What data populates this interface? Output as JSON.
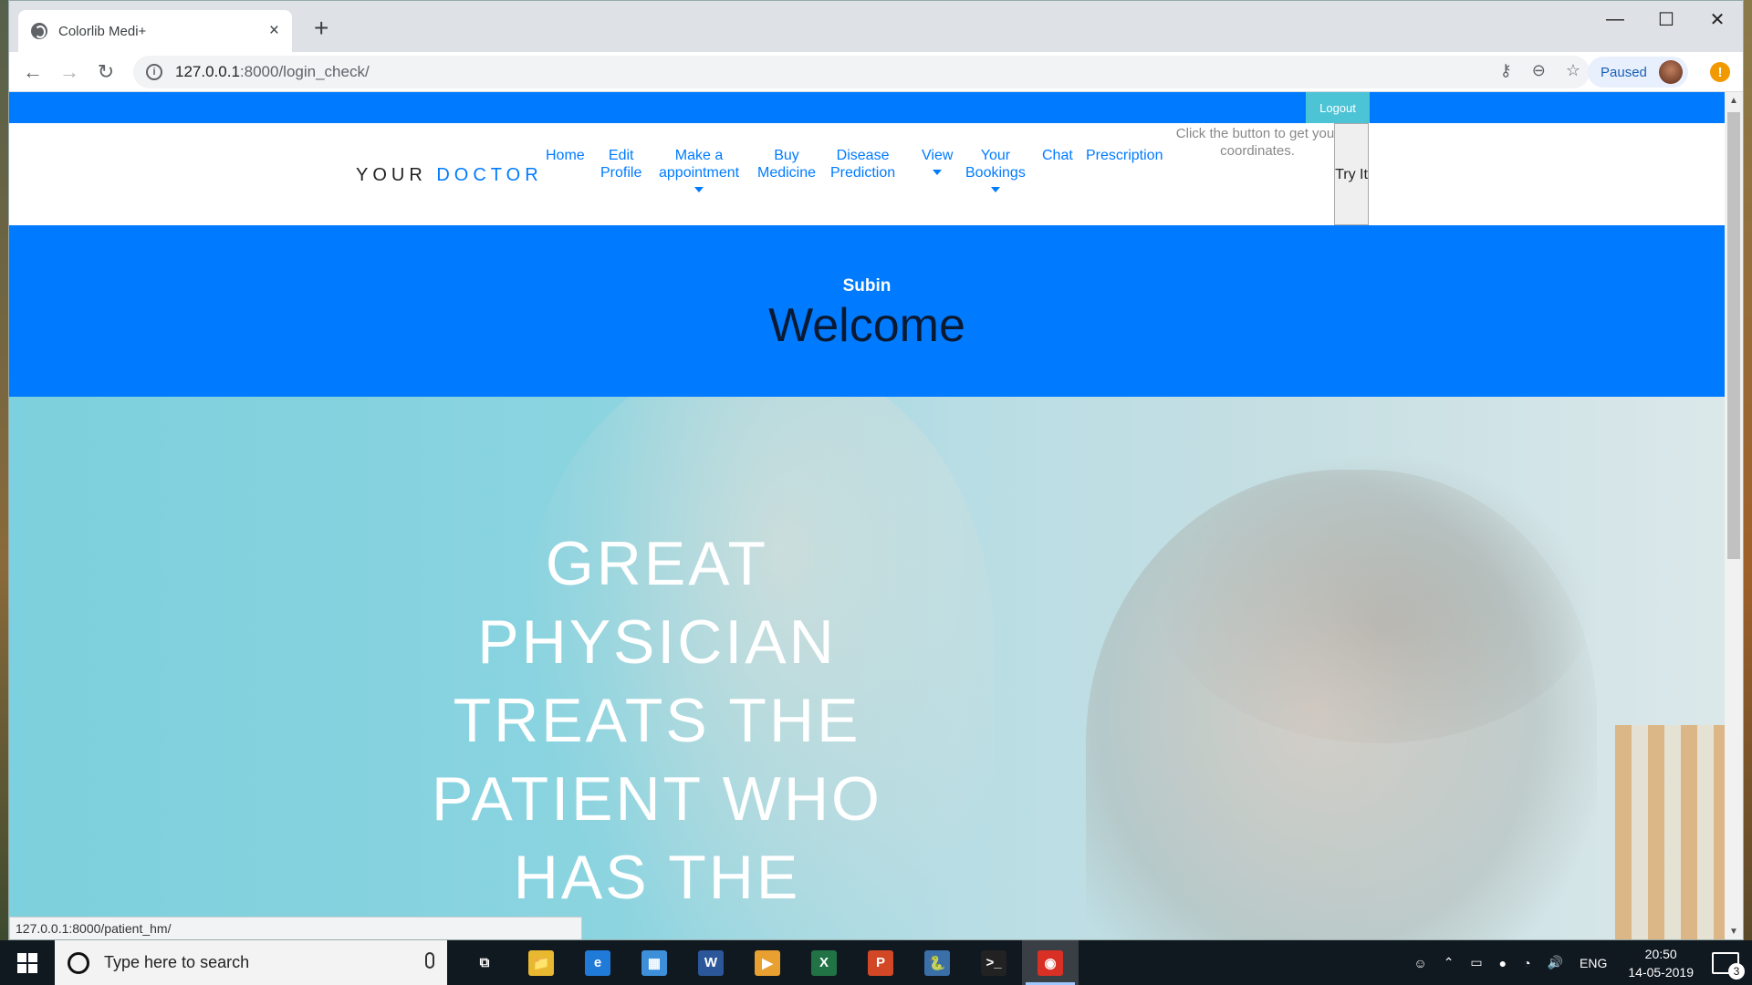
{
  "browser": {
    "tab_title": "Colorlib Medi+",
    "tab_close": "×",
    "new_tab": "+",
    "url_host": "127.0.0.1",
    "url_path": ":8000/login_check/",
    "profile_label": "Paused",
    "alert": "!",
    "status_url": "127.0.0.1:8000/patient_hm/",
    "window_controls": {
      "minimize": "—",
      "maximize": "☐",
      "close": "✕"
    }
  },
  "site": {
    "logout_label": "Logout",
    "brand_prefix": "YOUR",
    "brand_accent": "DOCTOR",
    "nav": [
      {
        "label_lines": [
          "Home"
        ],
        "dropdown": false
      },
      {
        "label_lines": [
          "Edit",
          "Profile"
        ],
        "dropdown": false
      },
      {
        "label_lines": [
          "Make a",
          "appointment"
        ],
        "dropdown": true
      },
      {
        "label_lines": [
          "Buy",
          "Medicine"
        ],
        "dropdown": false
      },
      {
        "label_lines": [
          "Disease",
          "Prediction"
        ],
        "dropdown": false
      },
      {
        "label_lines": [
          "View"
        ],
        "dropdown": true
      },
      {
        "label_lines": [
          "Your",
          "Bookings"
        ],
        "dropdown": true
      },
      {
        "label_lines": [
          "Chat"
        ],
        "dropdown": false
      },
      {
        "label_lines": [
          "Prescription"
        ],
        "dropdown": false
      }
    ],
    "coords_text": "Click the button to get your coordinates.",
    "try_button": "Try It",
    "welcome_name": "Subin",
    "welcome_title": "Welcome",
    "hero_text": "GREAT PHYSICIAN TREATS THE PATIENT WHO HAS THE",
    "colors": {
      "primary": "#007bff",
      "logout_bg": "#4dc4d6",
      "hero_tint": "#7dd0dd"
    }
  },
  "taskbar": {
    "search_placeholder": "Type here to search",
    "apps": [
      {
        "name": "task-view",
        "glyph": "⧉",
        "color": "#101820"
      },
      {
        "name": "file-explorer",
        "glyph": "📁",
        "color": "#e8b830"
      },
      {
        "name": "edge",
        "glyph": "e",
        "color": "#1f7ad8"
      },
      {
        "name": "control-panel",
        "glyph": "▦",
        "color": "#3c8fd8"
      },
      {
        "name": "word",
        "glyph": "W",
        "color": "#2b579a"
      },
      {
        "name": "media-player",
        "glyph": "▶",
        "color": "#e8a030"
      },
      {
        "name": "excel",
        "glyph": "X",
        "color": "#217346"
      },
      {
        "name": "powerpoint",
        "glyph": "P",
        "color": "#d24726"
      },
      {
        "name": "python",
        "glyph": "🐍",
        "color": "#3a6fa8"
      },
      {
        "name": "terminal",
        "glyph": ">_",
        "color": "#222"
      },
      {
        "name": "chrome",
        "glyph": "◉",
        "color": "#d93025"
      }
    ],
    "tray_lang": "ENG",
    "time": "20:50",
    "date": "14-05-2019",
    "notification_count": "3"
  }
}
